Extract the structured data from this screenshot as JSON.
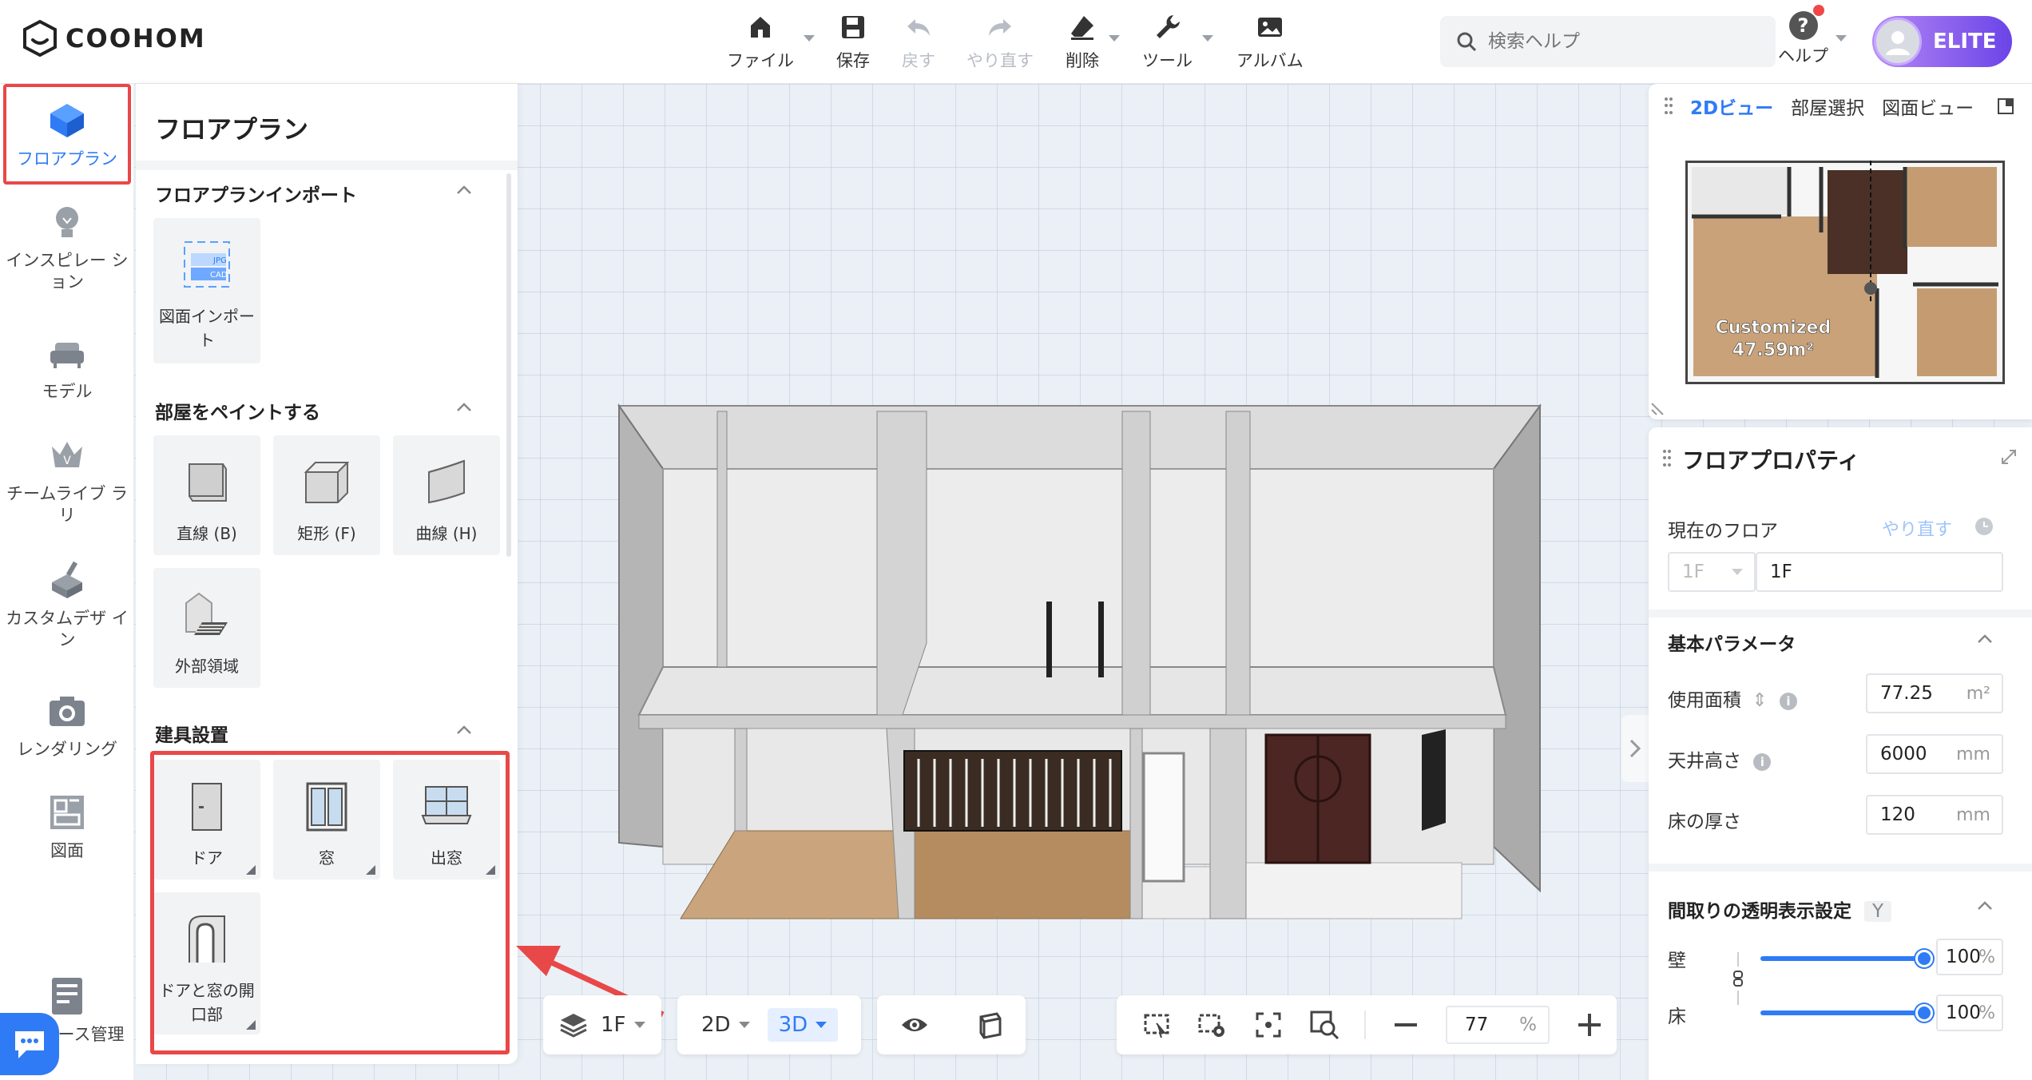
{
  "app": {
    "logo_text": "COOHOM"
  },
  "toolbar": {
    "items": [
      {
        "label": "ファイル",
        "icon": "home-file-icon",
        "has_menu": true
      },
      {
        "label": "保存",
        "icon": "save-icon",
        "has_menu": false
      },
      {
        "label": "戻す",
        "icon": "undo-icon",
        "has_menu": false,
        "disabled": true
      },
      {
        "label": "やり直す",
        "icon": "redo-icon",
        "has_menu": false,
        "disabled": true
      },
      {
        "label": "削除",
        "icon": "eraser-icon",
        "has_menu": true
      },
      {
        "label": "ツール",
        "icon": "wrench-icon",
        "has_menu": true
      },
      {
        "label": "アルバム",
        "icon": "album-icon",
        "has_menu": false
      }
    ],
    "search_placeholder": "検索ヘルプ",
    "help_label": "ヘルプ",
    "plan_badge": "ELITE"
  },
  "sidebar": {
    "items": [
      {
        "label": "フロアプラン",
        "icon": "floor-plan-icon",
        "active": true
      },
      {
        "label": "インスピレー ション",
        "icon": "lightbulb-icon"
      },
      {
        "label": "モデル",
        "icon": "sofa-icon"
      },
      {
        "label": "チームライブ ラリ",
        "icon": "crown-icon"
      },
      {
        "label": "カスタムデザ イン",
        "icon": "custom-design-icon"
      },
      {
        "label": "レンダリング",
        "icon": "camera-icon"
      },
      {
        "label": "図面",
        "icon": "blueprint-icon"
      },
      {
        "label": "ース管理",
        "icon": "resource-manage-icon"
      }
    ]
  },
  "catalog": {
    "title": "フロアプラン",
    "sections": [
      {
        "title": "フロアプランインポート",
        "tiles": [
          {
            "label": "図面インポート",
            "icon": "jpg-cad-import-icon"
          }
        ]
      },
      {
        "title": "部屋をペイントする",
        "tiles": [
          {
            "label": "直線 (B)",
            "icon": "cube-straight-icon"
          },
          {
            "label": "矩形 (F)",
            "icon": "cube-rect-icon"
          },
          {
            "label": "曲線 (H)",
            "icon": "cube-curve-icon"
          },
          {
            "label": "外部領域",
            "icon": "outdoor-area-icon"
          }
        ]
      },
      {
        "title": "建具設置",
        "tiles": [
          {
            "label": "ドア",
            "icon": "door-icon"
          },
          {
            "label": "窓",
            "icon": "window-icon"
          },
          {
            "label": "出窓",
            "icon": "bay-window-icon"
          },
          {
            "label": "ドアと窓の開口部",
            "icon": "opening-arch-icon"
          }
        ]
      }
    ],
    "jpg_tag": "JPG",
    "cad_tag": "CAD"
  },
  "minimap": {
    "tabs": [
      "2Dビュー",
      "部屋選択",
      "図面ビュー"
    ],
    "active_tab": 0,
    "room_name": "Customized",
    "room_area": "47.59m²"
  },
  "properties": {
    "title": "フロアプロパティ",
    "current_floor_label": "現在のフロア",
    "redo_label": "やり直す",
    "floor_select": "1F",
    "floor_name": "1F",
    "basic_params_title": "基本パラメータ",
    "params": [
      {
        "label": "使用面積",
        "value": "77.25",
        "unit": "m²"
      },
      {
        "label": "天井高さ",
        "value": "6000",
        "unit": "mm"
      },
      {
        "label": "床の厚さ",
        "value": "120",
        "unit": "mm"
      }
    ],
    "transparency_title": "間取りの透明表示設定",
    "transparency_tag": "Y",
    "transparency": [
      {
        "label": "壁",
        "value": "100",
        "unit": "%",
        "level": 1.0
      },
      {
        "label": "床",
        "value": "100",
        "unit": "%",
        "level": 1.0
      }
    ]
  },
  "bottom": {
    "floor": "1F",
    "view_2d": "2D",
    "view_3d": "3D",
    "zoom_value": "77",
    "zoom_unit": "%"
  },
  "colors": {
    "accent": "#2f7bf5",
    "highlight_red": "#e84848",
    "elite_gradient_start": "#b588f4",
    "elite_gradient_end": "#6b44e8"
  }
}
